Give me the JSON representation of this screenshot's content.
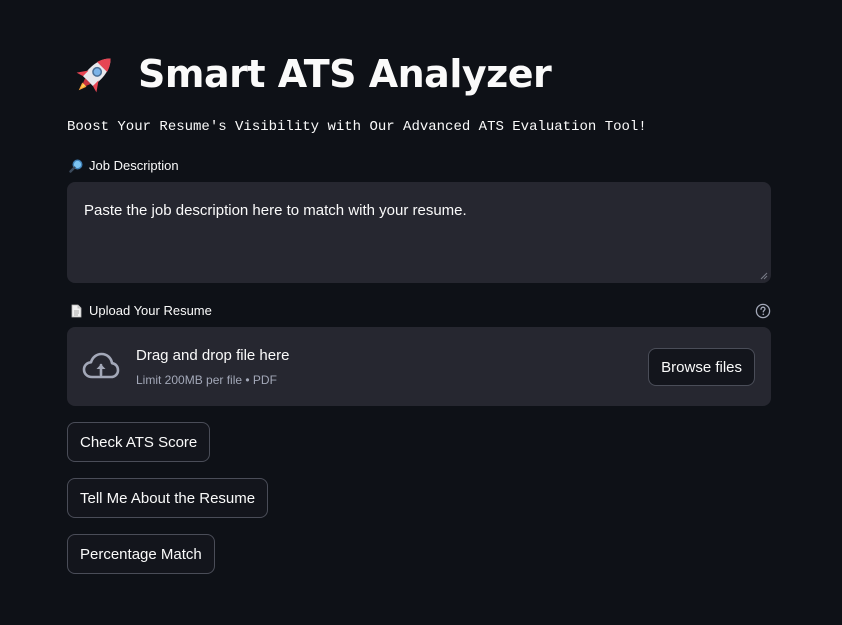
{
  "header": {
    "title_icon": "rocket-icon",
    "title": "Smart ATS Analyzer",
    "subtitle": "Boost Your Resume's Visibility with Our Advanced ATS Evaluation Tool!"
  },
  "job_description": {
    "label_icon": "magnifier-icon",
    "label": "Job Description",
    "placeholder": "Paste the job description here to match with your resume."
  },
  "upload": {
    "label_icon": "document-icon",
    "label": "Upload Your Resume",
    "help_icon": "question-circle-icon",
    "dropzone_icon": "cloud-upload-icon",
    "dropzone_title": "Drag and drop file here",
    "dropzone_limit": "Limit 200MB per file • PDF",
    "browse_label": "Browse files"
  },
  "actions": {
    "check_ats": "Check ATS Score",
    "tell_me": "Tell Me About the Resume",
    "percentage_match": "Percentage Match"
  },
  "colors": {
    "background": "#0e1117",
    "input_background": "#262730",
    "text": "#fafafa",
    "muted_text": "#a3a8b8",
    "button_border": "#4a4d58"
  }
}
